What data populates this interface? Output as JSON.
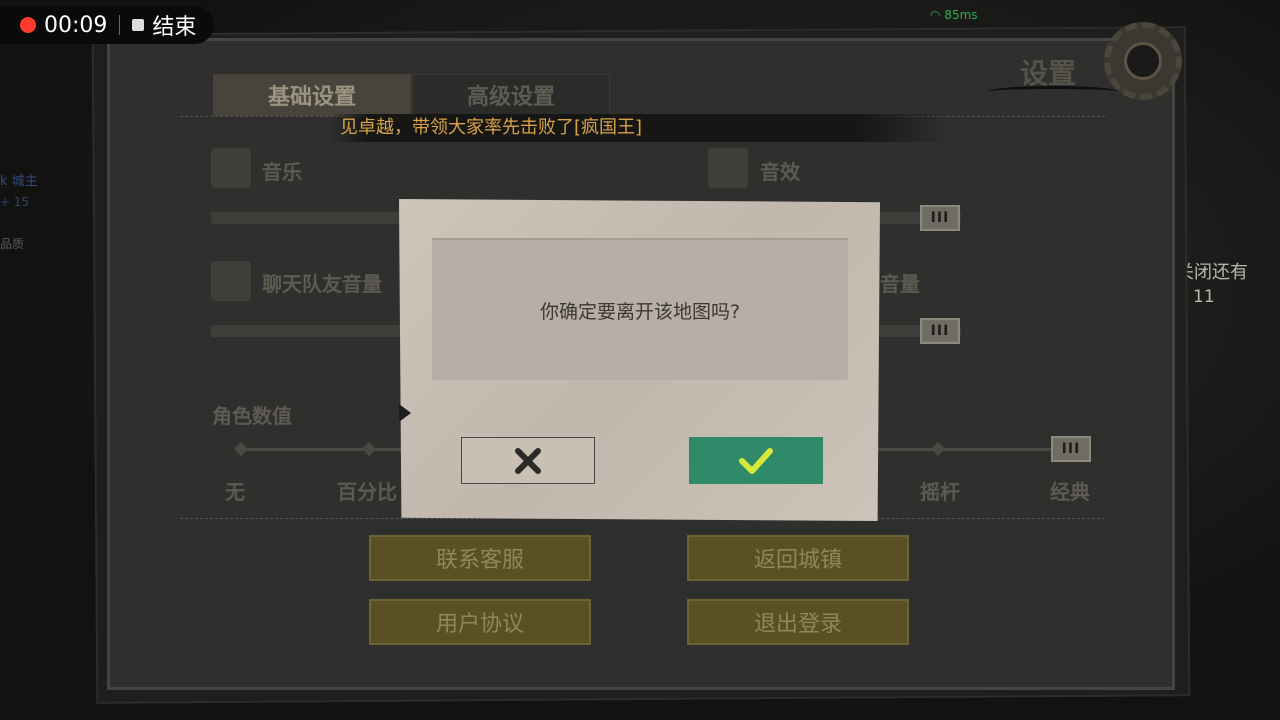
{
  "recording": {
    "time": "00:09",
    "end_label": "结束"
  },
  "status": {
    "signal": "85ms"
  },
  "background": {
    "side_left_1": "k 城主",
    "side_left_2": "+ 15",
    "side_left_3": "品质",
    "close_timer_label": "关闭还有",
    "close_timer_value": "11"
  },
  "settings": {
    "title": "设置",
    "tabs": [
      {
        "label": "基础设置"
      },
      {
        "label": "高级设置"
      }
    ],
    "marquee": "见卓越，带领大家率先击败了[疯国王]",
    "music_label": "音乐",
    "sfx_label": "音效",
    "chat_voice_label": "聊天队友音量",
    "voice_right_label": "音量",
    "slider_knob": "III",
    "role_value_label": "角色数值",
    "role_options": [
      "无",
      "百分比",
      "摇杆",
      "经典"
    ],
    "buttons": {
      "contact_service": "联系客服",
      "back_to_town": "返回城镇",
      "user_agreement": "用户协议",
      "logout": "退出登录"
    }
  },
  "dialog": {
    "message": "你确定要离开该地图吗?"
  },
  "colors": {
    "accent_green": "#2f8a6a",
    "gold_button": "#5a5024",
    "marquee_text": "#d9a348",
    "record_dot": "#ff3b30"
  },
  "icons": {
    "cancel": "close-icon",
    "confirm": "check-icon",
    "gear": "gear-icon"
  }
}
